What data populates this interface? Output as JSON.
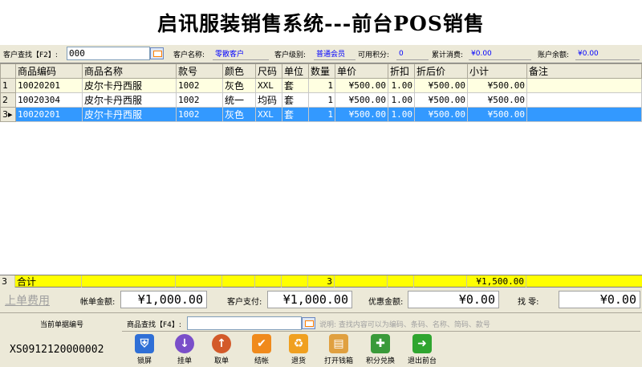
{
  "window": {
    "title": "启讯服装销售系统---前台POS销售"
  },
  "info_bar": {
    "customer_search_label": "客户查找【F2】:",
    "customer_search_value": "000",
    "customer_name_label": "客户名称:",
    "customer_name_value": "零散客户",
    "customer_level_label": "客户级别:",
    "customer_level_value": "普通会员",
    "points_label": "可用积分:",
    "points_value": "0",
    "cumulative_label": "累计消费:",
    "cumulative_value": "¥0.00",
    "balance_label": "账户余额:",
    "balance_value": "¥0.00"
  },
  "table": {
    "columns": [
      "商品编码",
      "商品名称",
      "款号",
      "颜色",
      "尺码",
      "单位",
      "数量",
      "单价",
      "折扣",
      "折后价",
      "小计",
      "备注"
    ],
    "rows": [
      {
        "idx": "1",
        "code": "10020201",
        "name": "皮尔卡丹西服",
        "style": "1002",
        "color": "灰色",
        "size": "XXL",
        "unit": "套",
        "qty": "1",
        "price": "¥500.00",
        "discount": "1.00",
        "disc_price": "¥500.00",
        "subtotal": "¥500.00",
        "note": ""
      },
      {
        "idx": "2",
        "code": "10020304",
        "name": "皮尔卡丹西服",
        "style": "1002",
        "color": "统一",
        "size": "均码",
        "unit": "套",
        "qty": "1",
        "price": "¥500.00",
        "discount": "1.00",
        "disc_price": "¥500.00",
        "subtotal": "¥500.00",
        "note": ""
      },
      {
        "idx": "3",
        "code": "10020201",
        "name": "皮尔卡丹西服",
        "style": "1002",
        "color": "灰色",
        "size": "XXL",
        "unit": "套",
        "qty": "1",
        "price": "¥500.00",
        "discount": "1.00",
        "disc_price": "¥500.00",
        "subtotal": "¥500.00",
        "note": ""
      }
    ],
    "total": {
      "count": "3",
      "label": "合计",
      "qty": "3",
      "subtotal": "¥1,500.00"
    }
  },
  "summary": {
    "prev_fee_label": "上单费用",
    "order_amount_label": "帐单金额:",
    "order_amount_value": "¥1,000.00",
    "customer_paid_label": "客户支付:",
    "customer_paid_value": "¥1,000.00",
    "discount_amount_label": "优惠金额:",
    "discount_amount_value": "¥0.00",
    "change_label": "找    零:",
    "change_value": "¥0.00"
  },
  "bottom": {
    "order_no_label": "当前单据编号",
    "order_no_value": "XS0912120000002",
    "product_search_label": "商品查找【F4】:",
    "product_search_value": "",
    "search_hint": "说明: 查找内容可以为编码、条码、名称、简码、款号"
  },
  "toolbar": [
    {
      "name": "lock-screen",
      "label": "锁屏",
      "icon": "shield-icon",
      "color": "#2f6fd6"
    },
    {
      "name": "hold-order",
      "label": "挂单",
      "icon": "down-arrow-icon",
      "color": "#7a4fc9"
    },
    {
      "name": "fetch-order",
      "label": "取单",
      "icon": "up-arrow-icon",
      "color": "#d35a2a"
    },
    {
      "name": "checkout",
      "label": "结帐",
      "icon": "checkmark-icon",
      "color": "#f08a1c"
    },
    {
      "name": "return-goods",
      "label": "退货",
      "icon": "recycle-icon",
      "color": "#f0a020"
    },
    {
      "name": "open-cash-drawer",
      "label": "打开钱箱",
      "icon": "cash-drawer-icon",
      "color": "#e0a040"
    },
    {
      "name": "points-exchange",
      "label": "积分兑换",
      "icon": "gift-icon",
      "color": "#3a9a3a"
    },
    {
      "name": "exit-front",
      "label": "退出前台",
      "icon": "right-arrow-icon",
      "color": "#2fa52f"
    }
  ]
}
